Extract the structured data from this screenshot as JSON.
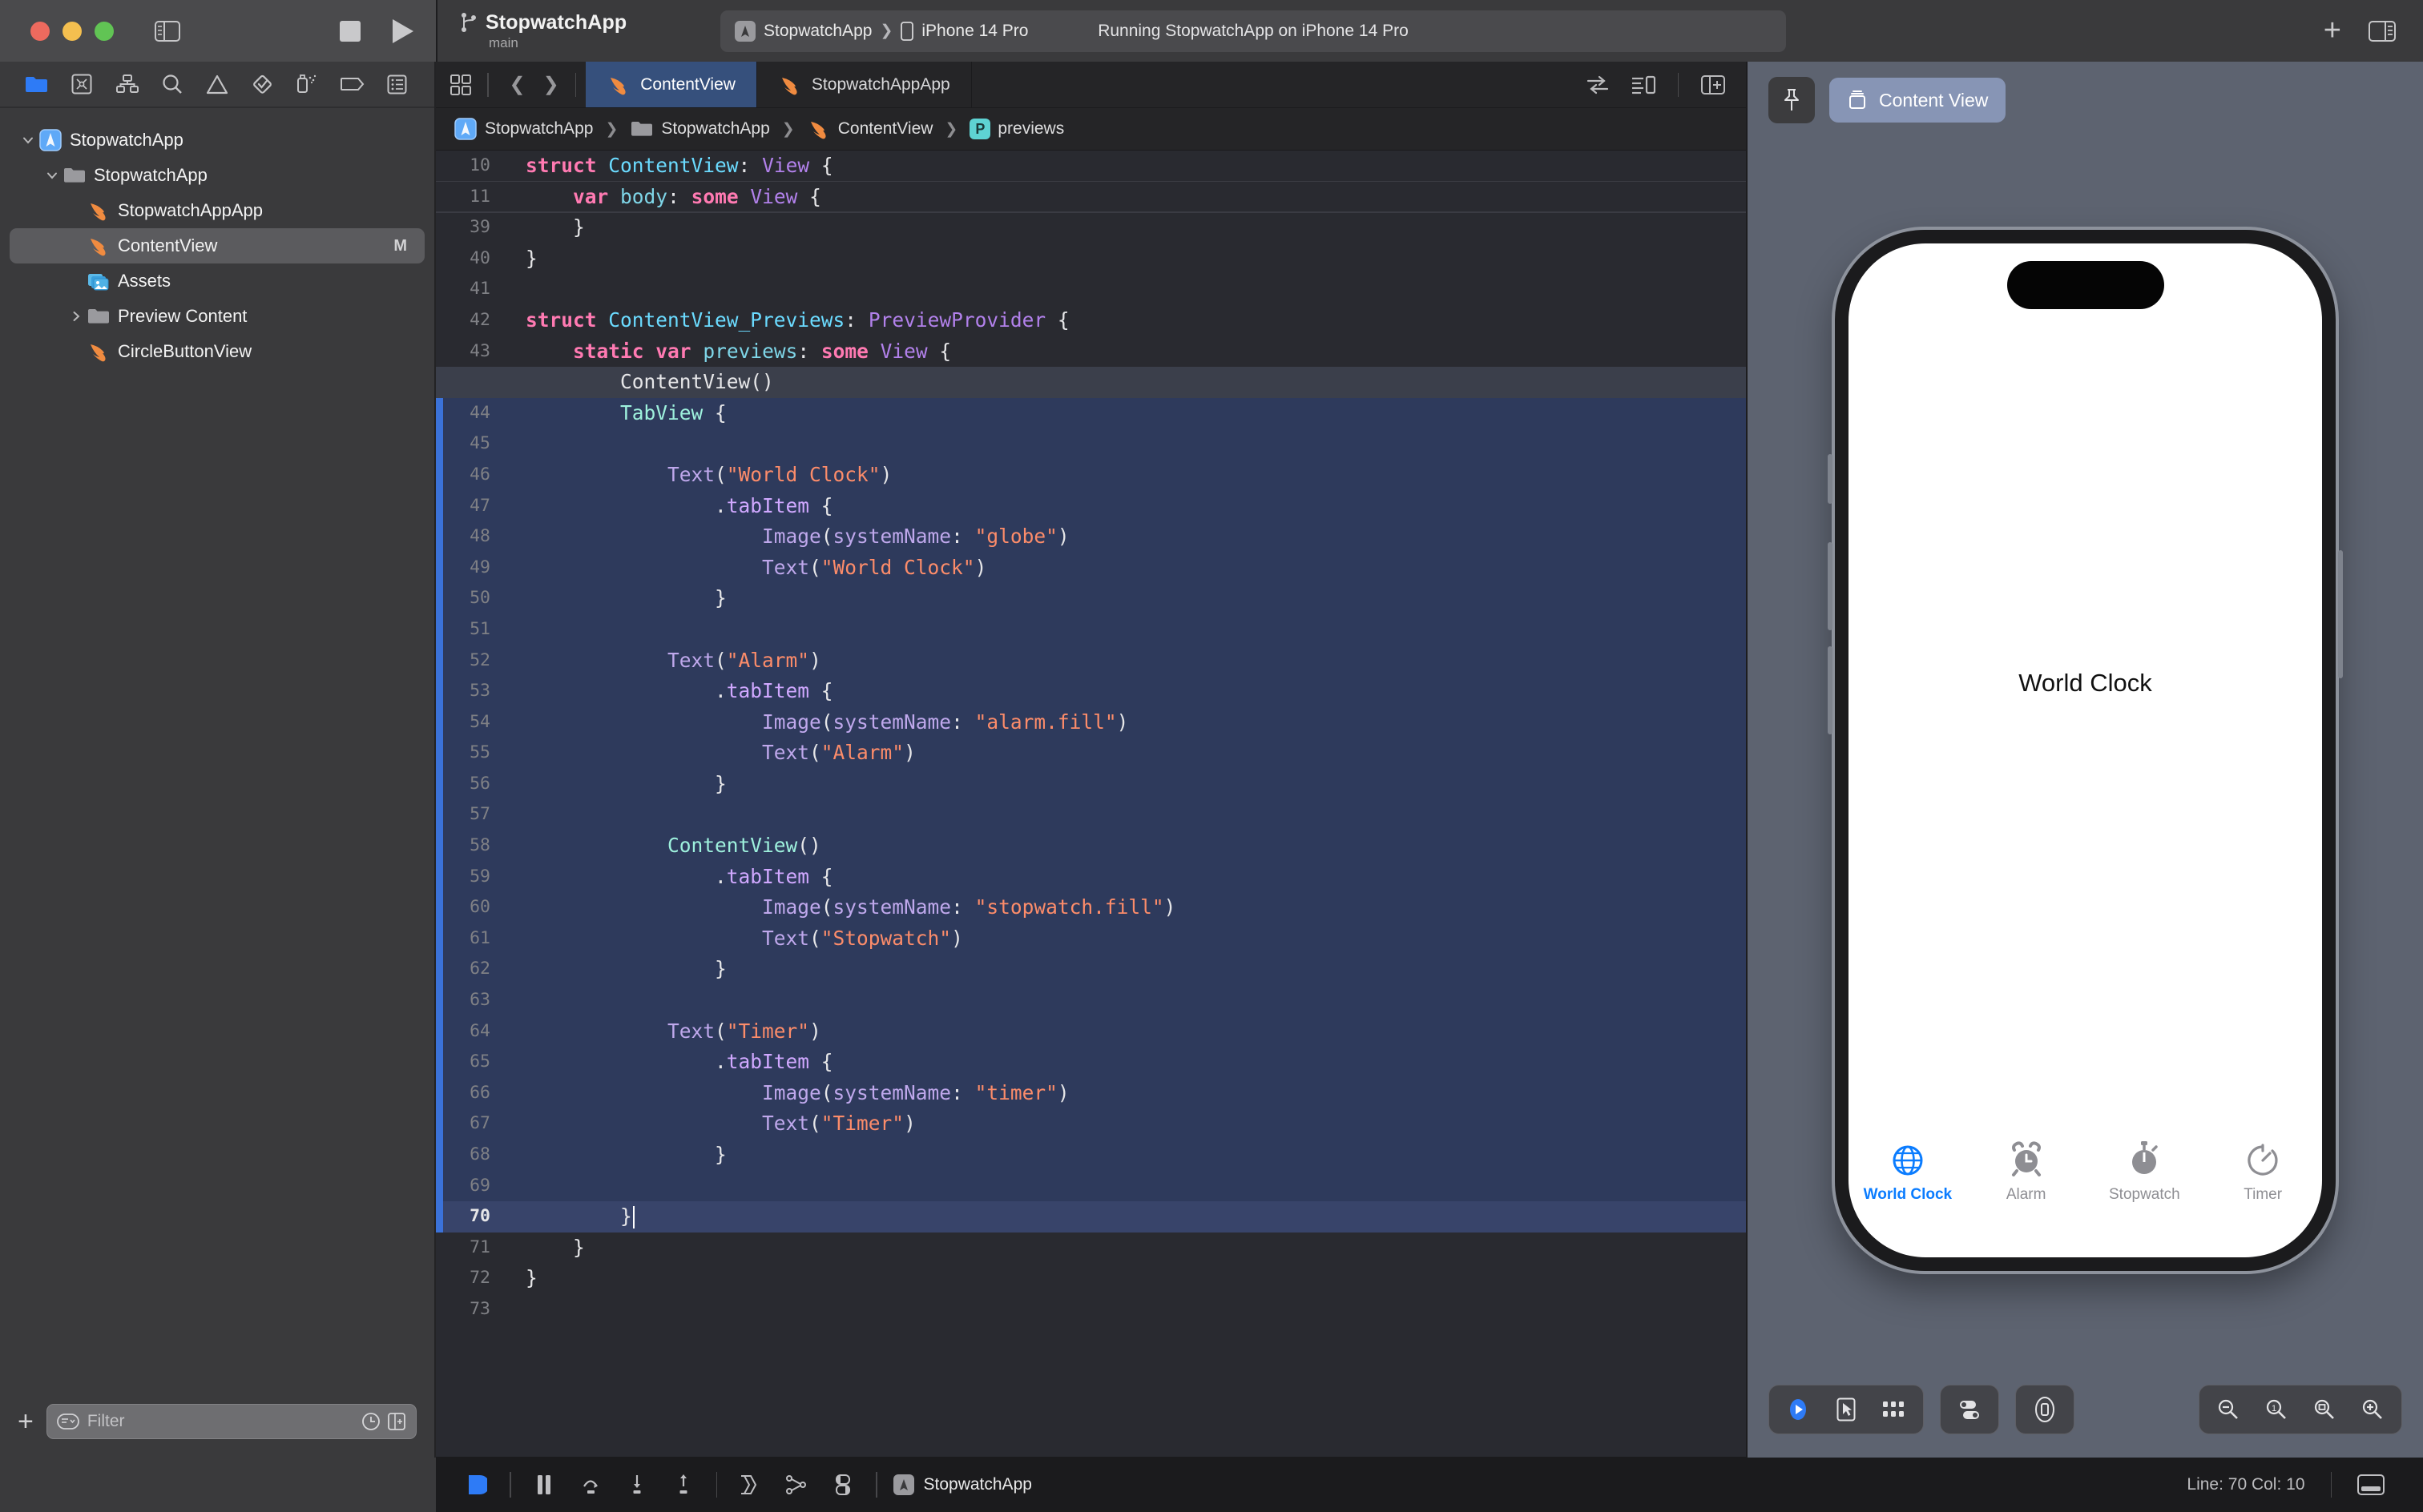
{
  "window": {
    "app_title": "StopwatchApp",
    "branch": "main",
    "traffic_lights": [
      "close",
      "minimize",
      "zoom"
    ],
    "toolbar_icons": [
      "sidebar-toggle-icon",
      "stop-icon",
      "run-icon",
      "branch-icon",
      "add-icon",
      "inspector-toggle-icon"
    ]
  },
  "status_bar": {
    "scheme": "StopwatchApp",
    "destination": "iPhone 14 Pro",
    "activity": "Running StopwatchApp on iPhone 14 Pro"
  },
  "navigator": {
    "toolbar_icons": [
      "folder-icon",
      "source-control-icon",
      "symbol-icon",
      "find-icon",
      "issue-icon",
      "test-icon",
      "debug-icon",
      "breakpoint-icon",
      "report-icon"
    ],
    "active_toolbar_icon": "folder-icon",
    "items": [
      {
        "label": "StopwatchApp",
        "icon": "app-project-icon",
        "indent": 0,
        "disclosure": "open",
        "selected": false,
        "badge": ""
      },
      {
        "label": "StopwatchApp",
        "icon": "folder-icon",
        "indent": 1,
        "disclosure": "open",
        "selected": false,
        "badge": ""
      },
      {
        "label": "StopwatchAppApp",
        "icon": "swift-file-icon",
        "indent": 2,
        "disclosure": "none",
        "selected": false,
        "badge": ""
      },
      {
        "label": "ContentView",
        "icon": "swift-file-icon",
        "indent": 2,
        "disclosure": "none",
        "selected": true,
        "badge": "M"
      },
      {
        "label": "Assets",
        "icon": "assets-icon",
        "indent": 2,
        "disclosure": "none",
        "selected": false,
        "badge": ""
      },
      {
        "label": "Preview Content",
        "icon": "folder-icon",
        "indent": 2,
        "disclosure": "closed",
        "selected": false,
        "badge": ""
      },
      {
        "label": "CircleButtonView",
        "icon": "swift-file-icon",
        "indent": 2,
        "disclosure": "none",
        "selected": false,
        "badge": ""
      }
    ],
    "filter": {
      "placeholder": "Filter",
      "value": ""
    }
  },
  "editor": {
    "tabs": [
      {
        "label": "ContentView",
        "icon": "swift-file-icon",
        "active": true
      },
      {
        "label": "StopwatchAppApp",
        "icon": "swift-file-icon",
        "active": false
      }
    ],
    "breadcrumb": [
      {
        "label": "StopwatchApp",
        "icon": "app-project-icon"
      },
      {
        "label": "StopwatchApp",
        "icon": "folder-icon"
      },
      {
        "label": "ContentView",
        "icon": "swift-file-icon"
      },
      {
        "label": "previews",
        "icon": "preview-symbol-icon"
      }
    ],
    "trailing_icons": [
      "related-items-icon",
      "editor-options-icon",
      "add-editor-icon"
    ],
    "lines": [
      {
        "n": "10",
        "indent": 0,
        "fold": false,
        "hl": false,
        "cur": false,
        "tokens": [
          [
            "kw",
            "struct"
          ],
          [
            "plain",
            " "
          ],
          [
            "typ",
            "ContentView"
          ],
          [
            "plain",
            ": "
          ],
          [
            "typ2",
            "View"
          ],
          [
            "plain",
            " {"
          ]
        ]
      },
      {
        "n": "11",
        "indent": 1,
        "fold": false,
        "hl": false,
        "cur": false,
        "tokens": [
          [
            "kw",
            "var"
          ],
          [
            "plain",
            " "
          ],
          [
            "prop",
            "body"
          ],
          [
            "plain",
            ": "
          ],
          [
            "kw",
            "some"
          ],
          [
            "plain",
            " "
          ],
          [
            "typ2",
            "View"
          ],
          [
            "plain",
            " {"
          ]
        ]
      },
      {
        "n": "39",
        "indent": 1,
        "fold": true,
        "hl": false,
        "cur": false,
        "tokens": [
          [
            "plain",
            "}"
          ]
        ]
      },
      {
        "n": "40",
        "indent": 0,
        "fold": true,
        "hl": false,
        "cur": false,
        "tokens": [
          [
            "plain",
            "}"
          ]
        ]
      },
      {
        "n": "41",
        "indent": 0,
        "fold": false,
        "hl": false,
        "cur": false,
        "tokens": []
      },
      {
        "n": "42",
        "indent": 0,
        "fold": true,
        "hl": false,
        "cur": false,
        "tokens": [
          [
            "kw",
            "struct"
          ],
          [
            "plain",
            " "
          ],
          [
            "typ",
            "ContentView_Previews"
          ],
          [
            "plain",
            ": "
          ],
          [
            "typ2",
            "PreviewProvider"
          ],
          [
            "plain",
            " {"
          ]
        ]
      },
      {
        "n": "43",
        "indent": 1,
        "fold": true,
        "hl": false,
        "cur": false,
        "tokens": [
          [
            "kw",
            "static"
          ],
          [
            "plain",
            " "
          ],
          [
            "kw",
            "var"
          ],
          [
            "plain",
            " "
          ],
          [
            "prop",
            "previews"
          ],
          [
            "plain",
            ": "
          ],
          [
            "kw",
            "some"
          ],
          [
            "plain",
            " "
          ],
          [
            "typ2",
            "View"
          ],
          [
            "plain",
            " {"
          ]
        ]
      },
      {
        "n": "",
        "indent": 2,
        "fold": false,
        "hl": false,
        "cur": true,
        "tokens": [
          [
            "plain",
            "ContentView()"
          ]
        ]
      },
      {
        "n": "44",
        "indent": 2,
        "fold": true,
        "hl": true,
        "cur": false,
        "tokens": [
          [
            "mint",
            "TabView"
          ],
          [
            "plain",
            " {"
          ]
        ]
      },
      {
        "n": "45",
        "indent": 0,
        "fold": true,
        "hl": true,
        "cur": false,
        "tokens": []
      },
      {
        "n": "46",
        "indent": 3,
        "fold": true,
        "hl": true,
        "cur": false,
        "tokens": [
          [
            "fn",
            "Text"
          ],
          [
            "plain",
            "("
          ],
          [
            "str",
            "\"World Clock\""
          ],
          [
            "plain",
            ")"
          ]
        ]
      },
      {
        "n": "47",
        "indent": 4,
        "fold": true,
        "hl": true,
        "cur": false,
        "tokens": [
          [
            "plain",
            "."
          ],
          [
            "pl",
            "tabItem"
          ],
          [
            "plain",
            " {"
          ]
        ]
      },
      {
        "n": "48",
        "indent": 5,
        "fold": true,
        "hl": true,
        "cur": false,
        "tokens": [
          [
            "fn",
            "Image"
          ],
          [
            "plain",
            "("
          ],
          [
            "fn",
            "systemName"
          ],
          [
            "plain",
            ": "
          ],
          [
            "str",
            "\"globe\""
          ],
          [
            "plain",
            ")"
          ]
        ]
      },
      {
        "n": "49",
        "indent": 5,
        "fold": true,
        "hl": true,
        "cur": false,
        "tokens": [
          [
            "fn",
            "Text"
          ],
          [
            "plain",
            "("
          ],
          [
            "str",
            "\"World Clock\""
          ],
          [
            "plain",
            ")"
          ]
        ]
      },
      {
        "n": "50",
        "indent": 4,
        "fold": true,
        "hl": true,
        "cur": false,
        "tokens": [
          [
            "plain",
            "}"
          ]
        ]
      },
      {
        "n": "51",
        "indent": 0,
        "fold": true,
        "hl": true,
        "cur": false,
        "tokens": []
      },
      {
        "n": "52",
        "indent": 3,
        "fold": true,
        "hl": true,
        "cur": false,
        "tokens": [
          [
            "fn",
            "Text"
          ],
          [
            "plain",
            "("
          ],
          [
            "str",
            "\"Alarm\""
          ],
          [
            "plain",
            ")"
          ]
        ]
      },
      {
        "n": "53",
        "indent": 4,
        "fold": true,
        "hl": true,
        "cur": false,
        "tokens": [
          [
            "plain",
            "."
          ],
          [
            "pl",
            "tabItem"
          ],
          [
            "plain",
            " {"
          ]
        ]
      },
      {
        "n": "54",
        "indent": 5,
        "fold": true,
        "hl": true,
        "cur": false,
        "tokens": [
          [
            "fn",
            "Image"
          ],
          [
            "plain",
            "("
          ],
          [
            "fn",
            "systemName"
          ],
          [
            "plain",
            ": "
          ],
          [
            "str",
            "\"alarm.fill\""
          ],
          [
            "plain",
            ")"
          ]
        ]
      },
      {
        "n": "55",
        "indent": 5,
        "fold": true,
        "hl": true,
        "cur": false,
        "tokens": [
          [
            "fn",
            "Text"
          ],
          [
            "plain",
            "("
          ],
          [
            "str",
            "\"Alarm\""
          ],
          [
            "plain",
            ")"
          ]
        ]
      },
      {
        "n": "56",
        "indent": 4,
        "fold": true,
        "hl": true,
        "cur": false,
        "tokens": [
          [
            "plain",
            "}"
          ]
        ]
      },
      {
        "n": "57",
        "indent": 0,
        "fold": true,
        "hl": true,
        "cur": false,
        "tokens": []
      },
      {
        "n": "58",
        "indent": 3,
        "fold": true,
        "hl": true,
        "cur": false,
        "tokens": [
          [
            "mint",
            "ContentView"
          ],
          [
            "plain",
            "()"
          ]
        ]
      },
      {
        "n": "59",
        "indent": 4,
        "fold": true,
        "hl": true,
        "cur": false,
        "tokens": [
          [
            "plain",
            "."
          ],
          [
            "pl",
            "tabItem"
          ],
          [
            "plain",
            " {"
          ]
        ]
      },
      {
        "n": "60",
        "indent": 5,
        "fold": true,
        "hl": true,
        "cur": false,
        "tokens": [
          [
            "fn",
            "Image"
          ],
          [
            "plain",
            "("
          ],
          [
            "fn",
            "systemName"
          ],
          [
            "plain",
            ": "
          ],
          [
            "str",
            "\"stopwatch.fill\""
          ],
          [
            "plain",
            ")"
          ]
        ]
      },
      {
        "n": "61",
        "indent": 5,
        "fold": true,
        "hl": true,
        "cur": false,
        "tokens": [
          [
            "fn",
            "Text"
          ],
          [
            "plain",
            "("
          ],
          [
            "str",
            "\"Stopwatch\""
          ],
          [
            "plain",
            ")"
          ]
        ]
      },
      {
        "n": "62",
        "indent": 4,
        "fold": true,
        "hl": true,
        "cur": false,
        "tokens": [
          [
            "plain",
            "}"
          ]
        ]
      },
      {
        "n": "63",
        "indent": 0,
        "fold": true,
        "hl": true,
        "cur": false,
        "tokens": []
      },
      {
        "n": "64",
        "indent": 3,
        "fold": true,
        "hl": true,
        "cur": false,
        "tokens": [
          [
            "fn",
            "Text"
          ],
          [
            "plain",
            "("
          ],
          [
            "str",
            "\"Timer\""
          ],
          [
            "plain",
            ")"
          ]
        ]
      },
      {
        "n": "65",
        "indent": 4,
        "fold": true,
        "hl": true,
        "cur": false,
        "tokens": [
          [
            "plain",
            "."
          ],
          [
            "pl",
            "tabItem"
          ],
          [
            "plain",
            " {"
          ]
        ]
      },
      {
        "n": "66",
        "indent": 5,
        "fold": true,
        "hl": true,
        "cur": false,
        "tokens": [
          [
            "fn",
            "Image"
          ],
          [
            "plain",
            "("
          ],
          [
            "fn",
            "systemName"
          ],
          [
            "plain",
            ": "
          ],
          [
            "str",
            "\"timer\""
          ],
          [
            "plain",
            ")"
          ]
        ]
      },
      {
        "n": "67",
        "indent": 5,
        "fold": true,
        "hl": true,
        "cur": false,
        "tokens": [
          [
            "fn",
            "Text"
          ],
          [
            "plain",
            "("
          ],
          [
            "str",
            "\"Timer\""
          ],
          [
            "plain",
            ")"
          ]
        ]
      },
      {
        "n": "68",
        "indent": 4,
        "fold": true,
        "hl": true,
        "cur": false,
        "tokens": [
          [
            "plain",
            "}"
          ]
        ]
      },
      {
        "n": "69",
        "indent": 0,
        "fold": true,
        "hl": true,
        "cur": false,
        "tokens": []
      },
      {
        "n": "70",
        "indent": 2,
        "fold": true,
        "hl": false,
        "cur": false,
        "curline": true,
        "tokens": [
          [
            "plain",
            "}"
          ],
          [
            "caret",
            "|"
          ]
        ]
      },
      {
        "n": "71",
        "indent": 1,
        "fold": true,
        "hl": false,
        "cur": false,
        "tokens": [
          [
            "plain",
            "}"
          ]
        ]
      },
      {
        "n": "72",
        "indent": 0,
        "fold": true,
        "hl": false,
        "cur": false,
        "tokens": [
          [
            "plain",
            "}"
          ]
        ]
      },
      {
        "n": "73",
        "indent": 0,
        "fold": false,
        "hl": false,
        "cur": false,
        "tokens": []
      }
    ]
  },
  "preview": {
    "pin_icon": "pin-icon",
    "selector_label": "Content View",
    "selector_icon": "preview-variant-icon",
    "device": {
      "screen_title": "World Clock",
      "tabs": [
        {
          "label": "World Clock",
          "icon": "globe-icon",
          "active": true
        },
        {
          "label": "Alarm",
          "icon": "alarm-fill-icon",
          "active": false
        },
        {
          "label": "Stopwatch",
          "icon": "stopwatch-fill-icon",
          "active": false
        },
        {
          "label": "Timer",
          "icon": "timer-icon",
          "active": false
        }
      ]
    },
    "controls_left": [
      "live-preview-icon",
      "selectable-preview-icon",
      "variants-icon"
    ],
    "controls_mid": [
      "device-settings-icon",
      "orientation-icon"
    ],
    "controls_zoom": [
      "zoom-out-icon",
      "zoom-actual-icon",
      "zoom-fit-icon",
      "zoom-in-icon"
    ],
    "accent_color": "#2e7bf6"
  },
  "bottom_bar": {
    "debug_icons": [
      "debug-area-icon",
      "pause-icon",
      "step-over-icon",
      "step-into-icon",
      "step-out-icon",
      "view-hierarchy-icon",
      "memory-graph-icon",
      "appearance-icon"
    ],
    "process_label": "StopwatchApp",
    "line_col": "Line: 70  Col: 10",
    "debug_toggle_icon": "debug-panel-icon"
  }
}
